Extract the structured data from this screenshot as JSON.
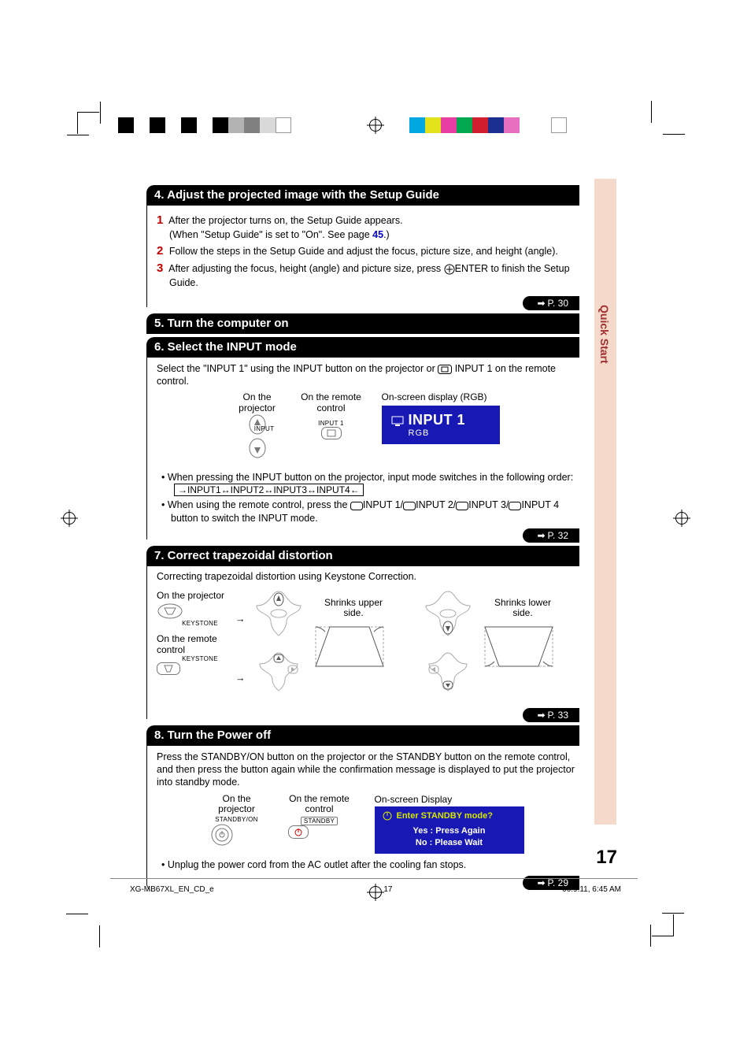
{
  "sections": {
    "s4": {
      "title": "4.  Adjust the projected image with the Setup Guide",
      "step1a": "After the projector turns on, the Setup Guide appears.",
      "step1b": "(When \"Setup Guide\" is set to \"On\". See page ",
      "step1_pagelink": "45",
      "step1c": ".)",
      "step2": "Follow the steps in the Setup Guide and adjust the focus, picture size, and height (angle).",
      "step3a": "After adjusting the focus, height (angle) and picture size, press ",
      "step3b": "ENTER to finish the Setup Guide.",
      "pref": "P. 30"
    },
    "s5": {
      "title": "5. Turn the computer on"
    },
    "s6": {
      "title": "6. Select the INPUT mode",
      "intro_a": "Select the \"INPUT 1\" using the INPUT button on the projector or ",
      "intro_b": " INPUT 1 on the remote control.",
      "on_projector": "On the projector",
      "on_remote": "On the remote control",
      "osd_label": "On-screen display (RGB)",
      "osd_big": "INPUT 1",
      "osd_small": "RGB",
      "remote_btn_label": "INPUT 1",
      "proj_btn_label": "INPUT",
      "bullet1": "When pressing the INPUT button on the projector, input mode switches in the following order:",
      "cycle": "INPUT1↔INPUT2↔INPUT3↔INPUT4",
      "bullet2a": "When using the remote control, press the ",
      "bullet2b": "INPUT 1/",
      "bullet2c": "INPUT 2/",
      "bullet2d": "INPUT 3/",
      "bullet2e": "INPUT 4 button to switch the INPUT mode.",
      "pref": "P. 32"
    },
    "s7": {
      "title": "7. Correct trapezoidal distortion",
      "intro": "Correcting trapezoidal distortion using Keystone Correction.",
      "on_projector": "On the projector",
      "on_remote": "On the remote control",
      "keystone_label": "KEYSTONE",
      "shrink_upper": "Shrinks upper side.",
      "shrink_lower": "Shrinks lower side.",
      "pref": "P. 33"
    },
    "s8": {
      "title": "8. Turn the Power off",
      "intro": "Press the STANDBY/ON button on the projector or the STANDBY button on the remote control, and then press the button again while the confirmation message is displayed to put the projector into standby mode.",
      "on_projector": "On the projector",
      "on_remote": "On the remote control",
      "osd_label": "On-screen Display",
      "proj_btn_label": "STANDBY/ON",
      "remote_btn_label": "STANDBY",
      "osd_q": "Enter STANDBY mode?",
      "osd_yes": "Yes : Press Again",
      "osd_no": "No : Please Wait",
      "bullet": "Unplug the power cord from the AC outlet after the cooling fan stops.",
      "pref": "P. 29"
    }
  },
  "side_tab": "Quick Start",
  "page_number_large": "17",
  "footer": {
    "left": "XG-MB67XL_EN_CD_e",
    "center": "17",
    "right": "06.9.11, 6:45 AM"
  },
  "colorbar_left": [
    "#000",
    "#000",
    "#000",
    "#000",
    "#fff",
    "#b3b3b3",
    "#808080",
    "#d9d9d9",
    "#fff",
    "#fff"
  ],
  "colorbar_right": [
    "#00a7e1",
    "#e2e21b",
    "#e83ea3",
    "#00a84f",
    "#d11f2f",
    "#1a2f8f",
    "#e86fc0",
    "#fff",
    "#fff",
    "#fff"
  ]
}
